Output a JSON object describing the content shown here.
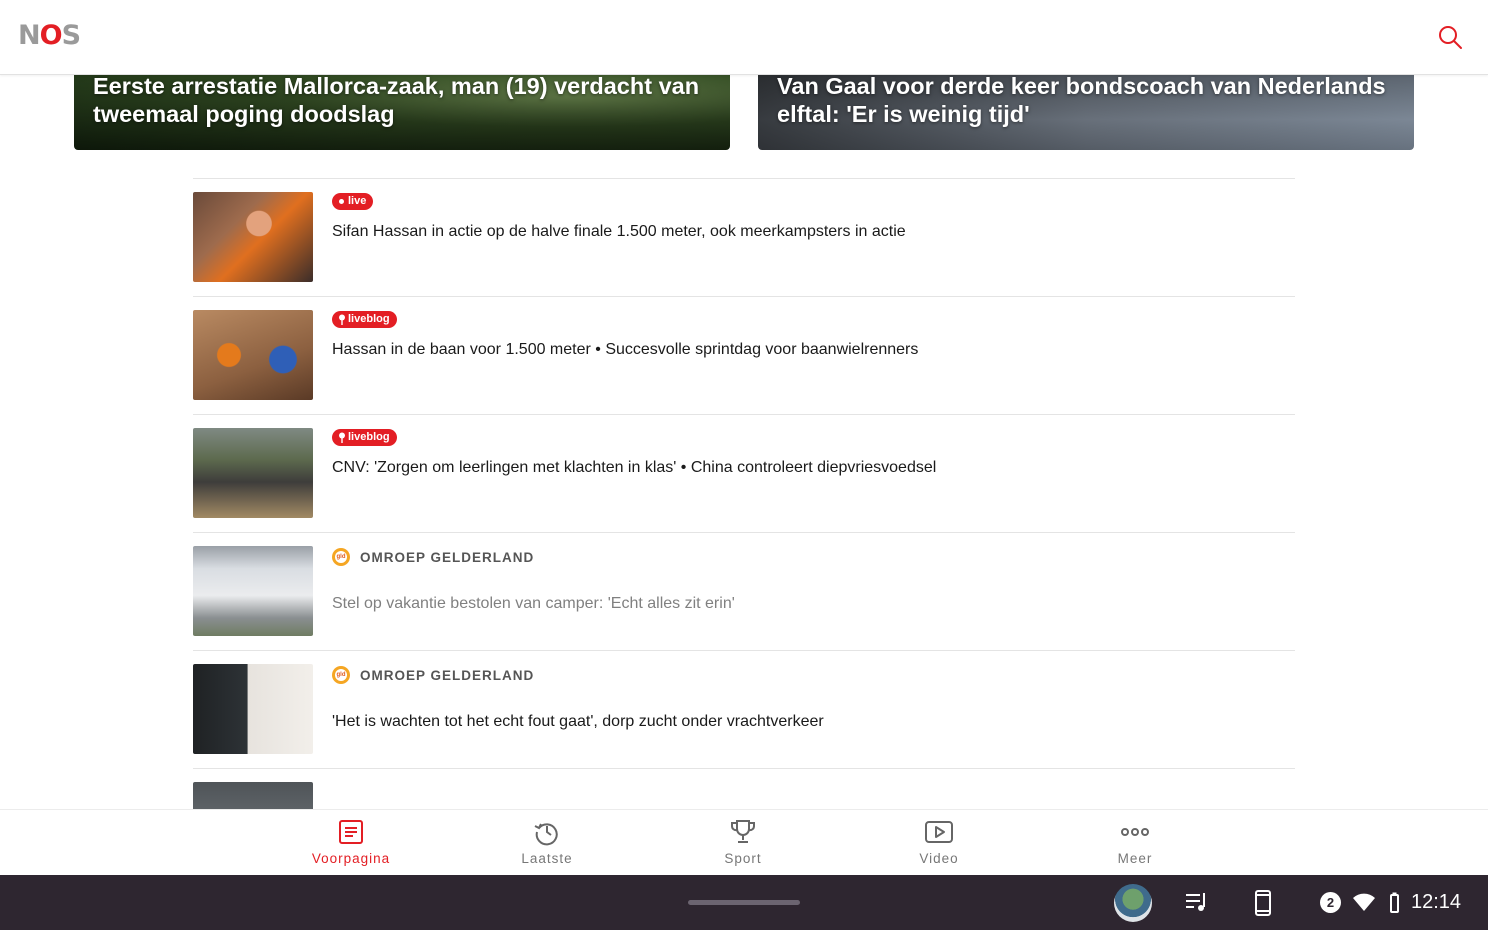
{
  "app": {
    "logo_text": "NOS"
  },
  "colors": {
    "accent": "#e31e24",
    "system_bar": "#2e2630"
  },
  "header": {
    "search_icon": "search-icon"
  },
  "hero": [
    {
      "title": "Eerste arrestatie Mallorca-zaak, man (19) verdacht van tweemaal poging doodslag"
    },
    {
      "title": "Van Gaal voor derde keer bondscoach van Nederlands elftal: 'Er is weinig tijd'"
    }
  ],
  "articles": [
    {
      "badge": "live",
      "headline": "Sifan Hassan in actie op de halve finale 1.500 meter, ook meerkampsters in actie"
    },
    {
      "badge": "liveblog",
      "headline": "Hassan in de baan voor 1.500 meter • Succesvolle sprintdag voor baanwielrenners"
    },
    {
      "badge": "liveblog",
      "headline": "CNV: 'Zorgen om leerlingen met klachten in klas' • China controleert diepvriesvoedsel"
    },
    {
      "source": "OMROEP GELDERLAND",
      "headline": "Stel op vakantie bestolen van camper: 'Echt alles zit erin'"
    },
    {
      "source": "OMROEP GELDERLAND",
      "headline": "'Het is wachten tot het echt fout gaat', dorp zucht onder vrachtverkeer"
    }
  ],
  "nav": [
    {
      "label": "Voorpagina",
      "icon": "newspaper-icon",
      "active": true
    },
    {
      "label": "Laatste",
      "icon": "history-icon"
    },
    {
      "label": "Sport",
      "icon": "trophy-icon"
    },
    {
      "label": "Video",
      "icon": "play-icon"
    },
    {
      "label": "Meer",
      "icon": "more-icon"
    }
  ],
  "system": {
    "notification_count": "2",
    "time": "12:14"
  }
}
